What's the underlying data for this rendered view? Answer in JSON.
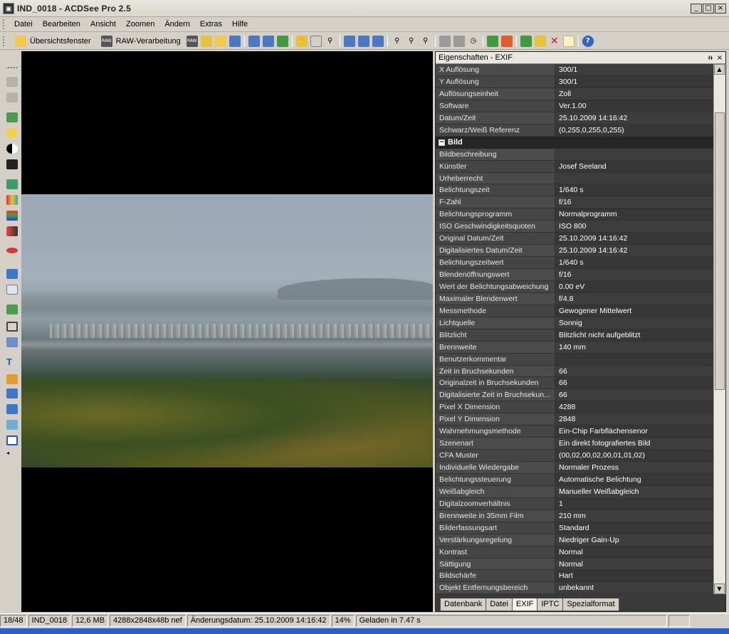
{
  "window": {
    "title": "IND_0018 - ACDSee Pro 2.5",
    "app_icon": "acdsee-icon",
    "buttons": [
      "_",
      "□",
      "×"
    ]
  },
  "menu": [
    "Datei",
    "Bearbeiten",
    "Ansicht",
    "Zoomen",
    "Ändern",
    "Extras",
    "Hilfe"
  ],
  "toolbar": {
    "overview_label": "Übersichtsfenster",
    "raw_label": "RAW-Verarbeitung"
  },
  "panel": {
    "title": "Eigenschaften - EXIF",
    "pin": "ᵰ",
    "close": "×",
    "section_bild": "Bild",
    "rows_top": [
      {
        "k": "X Auflösung",
        "v": "300/1"
      },
      {
        "k": "Y Auflösung",
        "v": "300/1"
      },
      {
        "k": "Auflösungseinheit",
        "v": "Zoll"
      },
      {
        "k": "Software",
        "v": "Ver.1.00"
      },
      {
        "k": "Datum/Zeit",
        "v": "25.10.2009 14:16:42"
      },
      {
        "k": "Schwarz/Weiß Referenz",
        "v": "(0,255,0,255,0,255)"
      }
    ],
    "rows_bild": [
      {
        "k": "Bildbeschreibung",
        "v": ""
      },
      {
        "k": "Künstler",
        "v": "Josef Seeland"
      },
      {
        "k": "Urheberrecht",
        "v": ""
      },
      {
        "k": "Belichtungszeit",
        "v": "1/640 s"
      },
      {
        "k": "F-Zahl",
        "v": "f/16"
      },
      {
        "k": "Belichtungsprogramm",
        "v": "Normalprogramm"
      },
      {
        "k": "ISO Geschwindigkeitsquoten",
        "v": "ISO 800"
      },
      {
        "k": "Original Datum/Zeit",
        "v": "25.10.2009 14:16:42"
      },
      {
        "k": "Digitalisiertes Datum/Zeit",
        "v": "25.10.2009 14:16:42"
      },
      {
        "k": "Belichtungszeitwert",
        "v": "1/640 s"
      },
      {
        "k": "Blendenöffnungswert",
        "v": "f/16"
      },
      {
        "k": "Wert der Belichtungsabweichung",
        "v": "0.00 eV"
      },
      {
        "k": "Maximaler Blendenwert",
        "v": "f/4.8"
      },
      {
        "k": "Messmethode",
        "v": "Gewogener Mittelwert"
      },
      {
        "k": "Lichtquelle",
        "v": "Sonnig"
      },
      {
        "k": "Blitzlicht",
        "v": "Blitzlicht nicht aufgeblitzt"
      },
      {
        "k": "Brennweite",
        "v": "140 mm"
      },
      {
        "k": "Benutzerkommentar",
        "v": ""
      },
      {
        "k": "Zeit in Bruchsekunden",
        "v": "66"
      },
      {
        "k": "Originalzeit in Bruchsekunden",
        "v": "66"
      },
      {
        "k": "Digitalisierte Zeit in Bruchsekun...",
        "v": "66"
      },
      {
        "k": "Pixel X Dimension",
        "v": "4288"
      },
      {
        "k": "Pixel Y Dimension",
        "v": "2848"
      },
      {
        "k": "Wahrnehmungsmethode",
        "v": "Ein-Chip Farbflächensenor"
      },
      {
        "k": "Szenenart",
        "v": "Ein direkt fotografiertes Bild"
      },
      {
        "k": "CFA Muster",
        "v": "(00,02,00,02,00,01,01,02)"
      },
      {
        "k": "Individuelle Wiedergabe",
        "v": "Normaler Prozess"
      },
      {
        "k": "Belichtungssteuerung",
        "v": "Automatische Belichtung"
      },
      {
        "k": "Weißabgleich",
        "v": "Manueller Weißabgleich"
      },
      {
        "k": "Digitalzoomverhältnis",
        "v": "1"
      },
      {
        "k": "Brennweite in 35mm Film",
        "v": "210 mm"
      },
      {
        "k": "Bilderfassungsart",
        "v": "Standard"
      },
      {
        "k": "Verstärkungsregelung",
        "v": "Niedriger Gain-Up"
      },
      {
        "k": "Kontrast",
        "v": "Normal"
      },
      {
        "k": "Sättigung",
        "v": "Normal"
      },
      {
        "k": "Bildschärfe",
        "v": "Hart"
      },
      {
        "k": "Objekt Entfernungsbereich",
        "v": "unbekannt"
      }
    ],
    "tabs": [
      "Datenbank",
      "Datei",
      "EXIF",
      "IPTC",
      "Spezialformat"
    ],
    "active_tab": "EXIF"
  },
  "status": {
    "index": "18/48",
    "filename": "IND_0018",
    "size": "12,6 MB",
    "dims": "4288x2848x48b nef",
    "modified": "Änderungsdatum: 25.10.2009 14:16:42",
    "zoom": "14%",
    "loaded": "Geladen in 7.47 s"
  }
}
